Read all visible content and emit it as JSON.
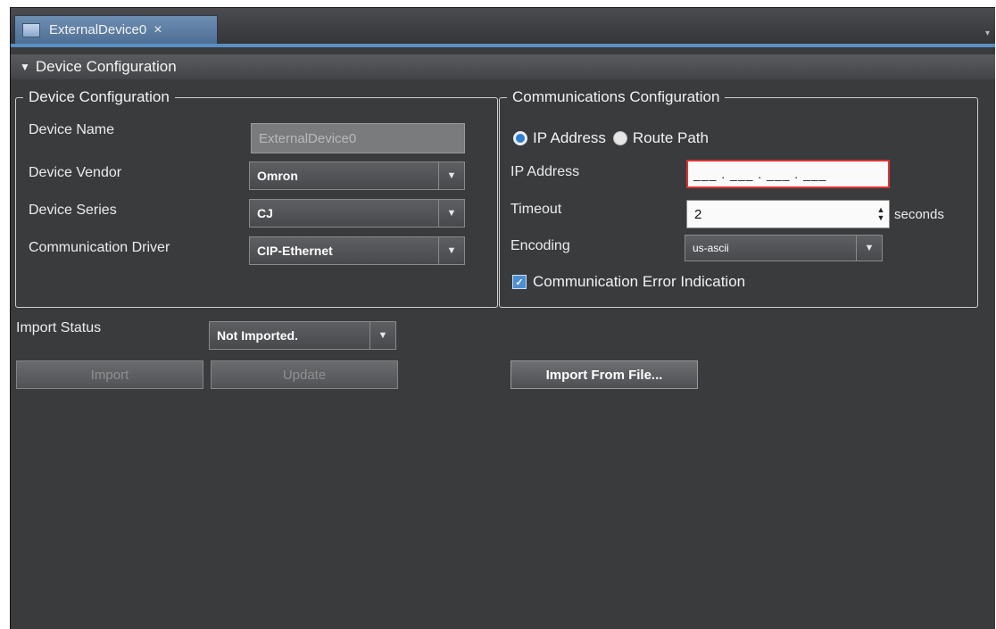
{
  "tab": {
    "label": "ExternalDevice0",
    "close_glyph": "×"
  },
  "section": {
    "arrow": "▼",
    "title": "Device Configuration"
  },
  "device_group": {
    "legend": "Device Configuration",
    "device_name_label": "Device Name",
    "device_name_value": "ExternalDevice0",
    "vendor_label": "Device Vendor",
    "vendor_value": "Omron",
    "series_label": "Device Series",
    "series_value": "CJ",
    "driver_label": "Communication Driver",
    "driver_value": "CIP-Ethernet"
  },
  "comm_group": {
    "legend": "Communications Configuration",
    "radio_ip_label": "IP Address",
    "radio_route_label": "Route Path",
    "ip_label": "IP Address",
    "ip_value": "___ . ___ . ___ . ___",
    "timeout_label": "Timeout",
    "timeout_value": "2",
    "timeout_unit": "seconds",
    "encoding_label": "Encoding",
    "encoding_value": "us-ascii",
    "error_indication_label": "Communication Error Indication"
  },
  "import": {
    "status_label": "Import Status",
    "status_value": "Not Imported.",
    "import_button": "Import",
    "update_button": "Update",
    "import_file_button": "Import From File..."
  },
  "icons": {
    "dropdown": "▼",
    "checkbox": "✓",
    "spinner_up": "▲",
    "spinner_down": "▼"
  }
}
